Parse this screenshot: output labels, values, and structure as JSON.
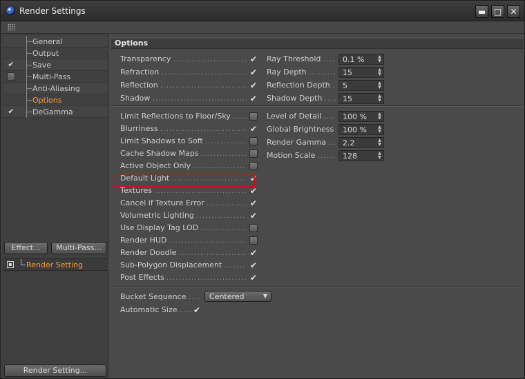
{
  "window": {
    "title": "Render Settings",
    "minimize_glyph": "▬",
    "maximize_glyph": "□",
    "close_glyph": "✕"
  },
  "sidebar": {
    "items": [
      {
        "label": "General",
        "checkbox": "none",
        "active": false
      },
      {
        "label": "Output",
        "checkbox": "none",
        "active": false
      },
      {
        "label": "Save",
        "checkbox": "checked",
        "active": false
      },
      {
        "label": "Multi-Pass",
        "checkbox": "unchecked",
        "active": false
      },
      {
        "label": "Anti-Aliasing",
        "checkbox": "none",
        "active": false
      },
      {
        "label": "Options",
        "checkbox": "none",
        "active": true
      },
      {
        "label": "DeGamma",
        "checkbox": "checked",
        "active": false
      }
    ],
    "effect_button": "Effect...",
    "multipass_button": "Multi-Pass...",
    "render_setting_item": "Render Setting",
    "render_setting_button": "Render Setting..."
  },
  "section": {
    "title": "Options"
  },
  "left_group1": [
    {
      "label": "Transparency",
      "checked": true
    },
    {
      "label": "Refraction",
      "checked": true
    },
    {
      "label": "Reflection",
      "checked": true
    },
    {
      "label": "Shadow",
      "checked": true
    }
  ],
  "right_group1": [
    {
      "label": "Ray Threshold",
      "value": "0.1 %"
    },
    {
      "label": "Ray Depth",
      "value": "15"
    },
    {
      "label": "Reflection Depth",
      "value": "5"
    },
    {
      "label": "Shadow Depth",
      "value": "15"
    }
  ],
  "left_group2": [
    {
      "label": "Limit Reflections to Floor/Sky",
      "checked": false
    },
    {
      "label": "Blurriness",
      "checked": true
    },
    {
      "label": "Limit Shadows to Soft",
      "checked": false
    },
    {
      "label": "Cache Shadow Maps",
      "checked": false
    },
    {
      "label": "Active Object Only",
      "checked": false
    },
    {
      "label": "Default Light",
      "checked": true
    },
    {
      "label": "Textures",
      "checked": true
    },
    {
      "label": "Cancel if Texture Error",
      "checked": true
    },
    {
      "label": "Volumetric Lighting",
      "checked": true
    },
    {
      "label": "Use Display Tag LOD",
      "checked": false
    },
    {
      "label": "Render HUD",
      "checked": false
    },
    {
      "label": "Render Doodle",
      "checked": true
    },
    {
      "label": "Sub-Polygon Displacement",
      "checked": true
    },
    {
      "label": "Post Effects",
      "checked": true
    }
  ],
  "right_group2": [
    {
      "label": "Level of Detail",
      "value": "100 %"
    },
    {
      "label": "Global Brightness",
      "value": "100 %"
    },
    {
      "label": "Render Gamma",
      "value": "2.2"
    },
    {
      "label": "Motion Scale",
      "value": "128"
    }
  ],
  "bottom": {
    "bucket_label": "Bucket Sequence",
    "bucket_value": "Centered",
    "autosize_label": "Automatic Size",
    "autosize_checked": true
  },
  "glyphs": {
    "check": "✔",
    "spin": "▲▼",
    "dropdown_arrow": "▼",
    "expand": "▪"
  },
  "colors": {
    "active_item": "#ff9e2e",
    "highlight_box": "#c4161c"
  }
}
